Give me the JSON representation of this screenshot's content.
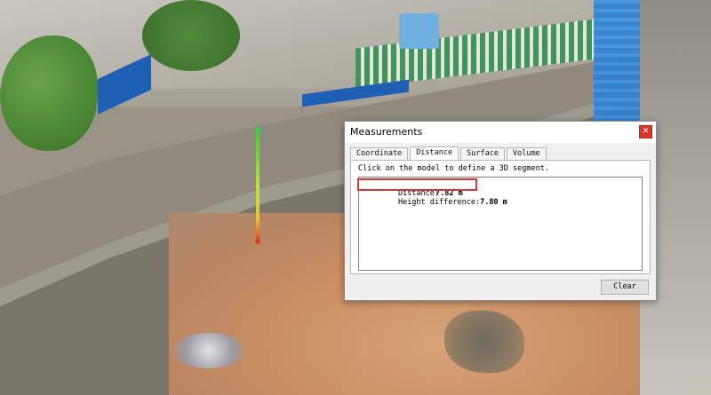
{
  "dialog": {
    "title": "Measurements",
    "close_symbol": "✕",
    "tabs": [
      {
        "label": "Coordinate"
      },
      {
        "label": "Distance"
      },
      {
        "label": "Surface"
      },
      {
        "label": "Volume"
      }
    ],
    "active_tab": "Distance",
    "instruction": "Click on the model to define a 3D segment.",
    "results": {
      "distance_label": "Distance:",
      "distance_value": "7.82 m",
      "height_label": "Height difference:",
      "height_value": "7.80 m"
    },
    "clear_label": "Clear",
    "highlight_color": "#d43834"
  },
  "scene": {
    "measure_line_start_color": "#2ed347",
    "measure_line_end_color": "#e0352a"
  }
}
